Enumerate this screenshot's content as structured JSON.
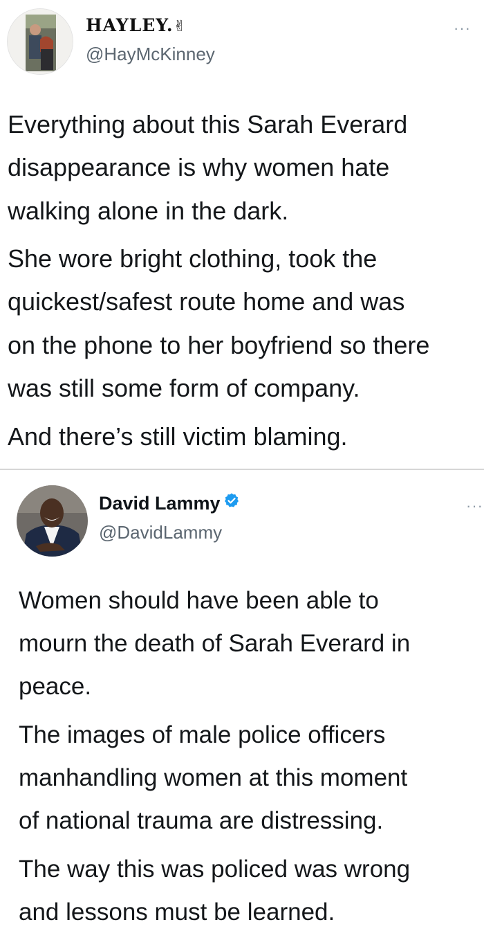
{
  "tweets": [
    {
      "display_name": "HAYLEY.",
      "name_emoji": "✌",
      "handle": "@HayMcKinney",
      "more": "···",
      "paragraphs": [
        [
          "Everything about this Sarah Everard",
          "disappearance is why women hate",
          "walking alone in the dark."
        ],
        [
          "She wore bright clothing, took the",
          "quickest/safest route home and was",
          "on the phone to her boyfriend so there",
          "was still some form of company."
        ],
        [
          "And there’s still victim blaming."
        ]
      ]
    },
    {
      "display_name": "David Lammy",
      "verified": true,
      "handle": "@DavidLammy",
      "more": "···",
      "paragraphs": [
        [
          "Women should have been able to",
          "mourn the death of Sarah Everard in",
          "peace."
        ],
        [
          "The images of male police officers",
          "manhandling women at this moment",
          "of national trauma are distressing."
        ],
        [
          "The way this was policed was wrong",
          "and lessons must be learned."
        ]
      ]
    }
  ],
  "colors": {
    "text": "#14171a",
    "secondary": "#5b6670",
    "verified_blue": "#1d9bf0",
    "divider": "#d6d6d6"
  }
}
